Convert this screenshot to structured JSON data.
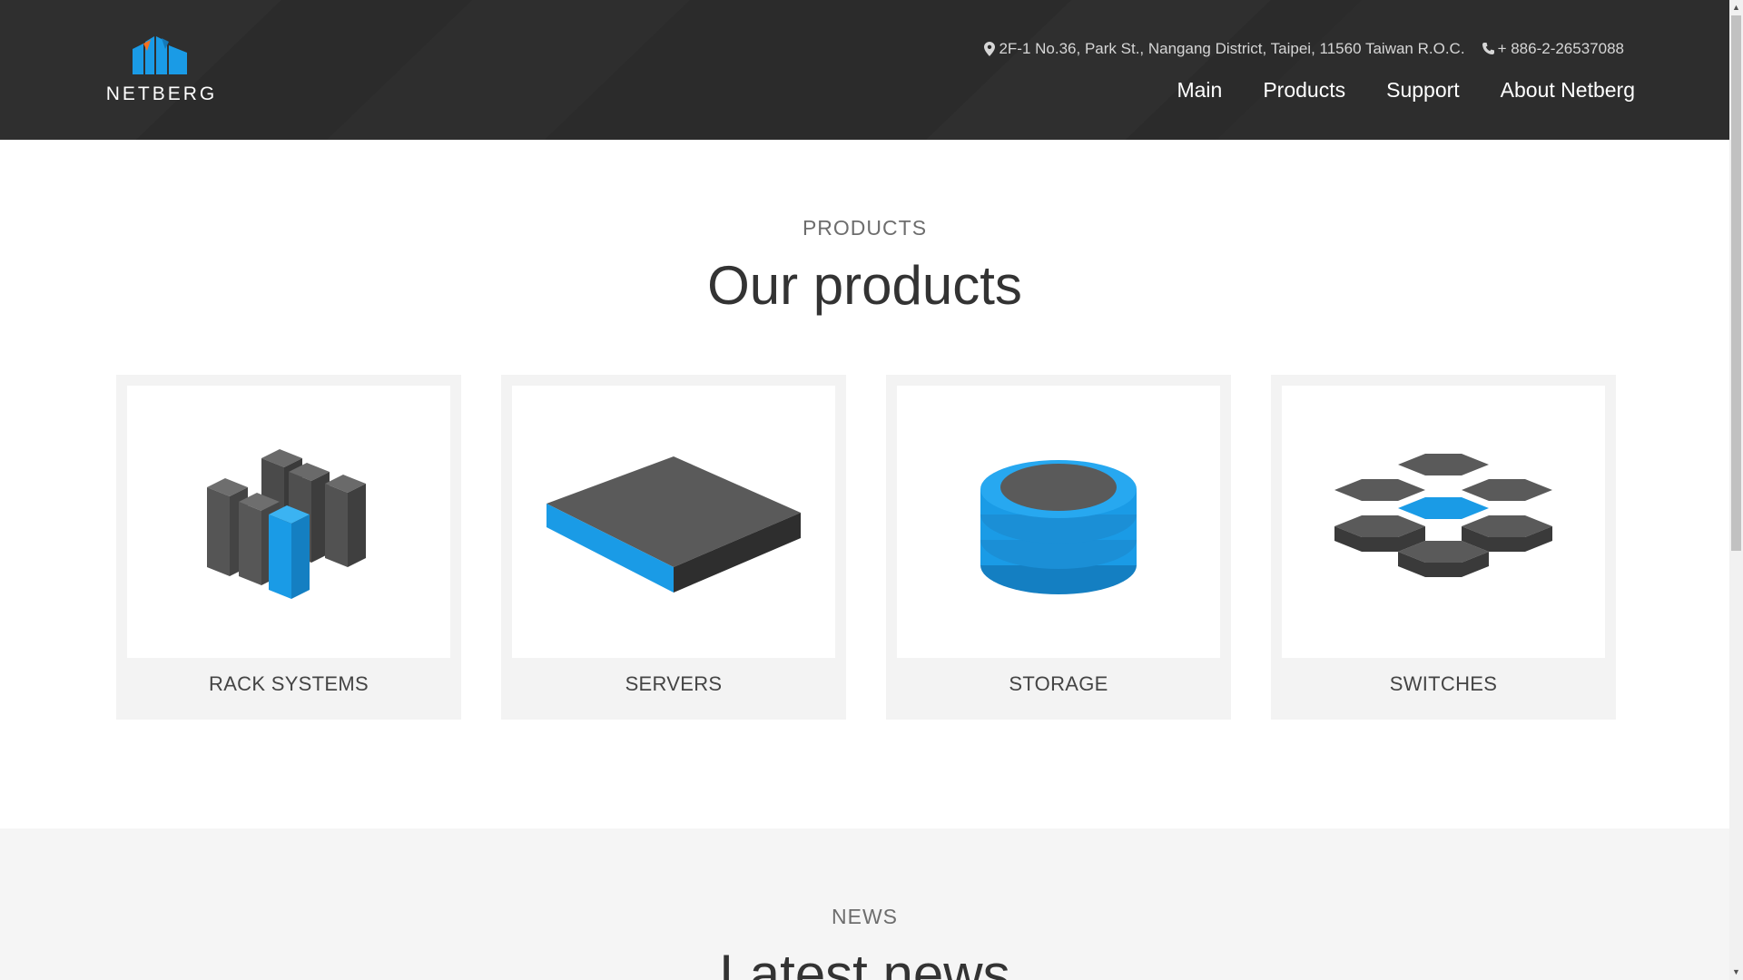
{
  "header": {
    "logo_text": "NETBERG",
    "address": "2F-1 No.36, Park St., Nangang District, Taipei, 11560 Taiwan R.O.C.",
    "phone": "+ 886-2-26537088",
    "nav": [
      "Main",
      "Products",
      "Support",
      "About Netberg"
    ]
  },
  "products": {
    "kicker": "PRODUCTS",
    "title": "Our products",
    "items": [
      {
        "label": "RACK SYSTEMS",
        "icon": "rack-systems-icon"
      },
      {
        "label": "SERVERS",
        "icon": "servers-icon"
      },
      {
        "label": "STORAGE",
        "icon": "storage-icon"
      },
      {
        "label": "SWITCHES",
        "icon": "switches-icon"
      }
    ]
  },
  "news": {
    "kicker": "NEWS",
    "title": "Latest news"
  },
  "colors": {
    "header_bg": "#2b2b2b",
    "accent_blue": "#1a9be6",
    "accent_orange": "#f37021",
    "icon_gray": "#555555"
  }
}
